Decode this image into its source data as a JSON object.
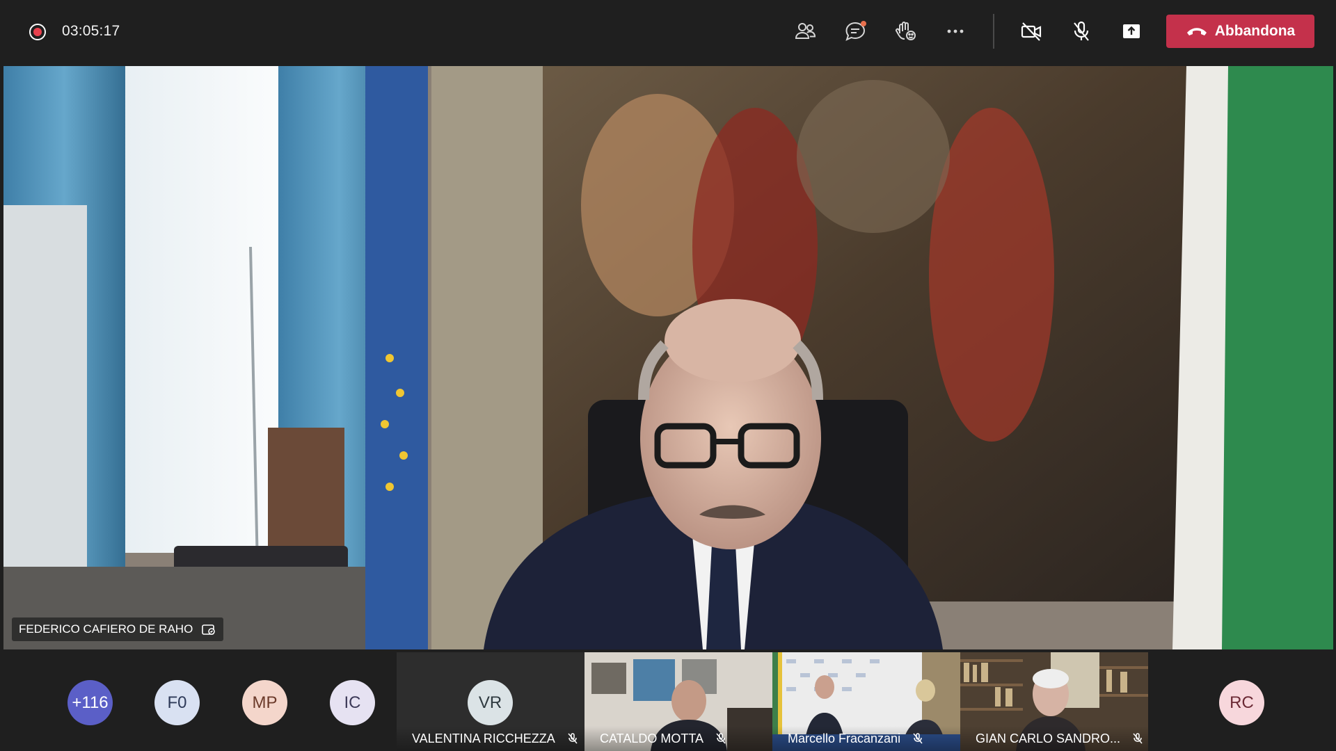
{
  "toolbar": {
    "recording_time": "03:05:17",
    "leave_label": "Abbandona",
    "icons": [
      "participants-icon",
      "chat-icon",
      "reactions-icon",
      "more-icon",
      "camera-off-icon",
      "mic-off-icon",
      "share-icon",
      "hang-up-icon"
    ],
    "chat_badge_color": "#e8704d",
    "leave_color": "#c4314b"
  },
  "main_speaker": {
    "name": "FEDERICO CAFIERO DE RAHO"
  },
  "participants": {
    "overflow_count": "+116",
    "avatars": [
      {
        "initials": "F0",
        "bg": "#d9e1f2",
        "fg": "#2e3a59"
      },
      {
        "initials": "MP",
        "bg": "#f4d6cb",
        "fg": "#6b3a2a"
      },
      {
        "initials": "IC",
        "bg": "#e6e2f2",
        "fg": "#3d3a59"
      },
      {
        "initials": "RC",
        "bg": "#f7d7dc",
        "fg": "#6b2a35"
      }
    ],
    "overflow_bg": "#5b5fc7",
    "tiles": [
      {
        "initials": "VR",
        "name": "VALENTINA RICCHEZZA"
      },
      {
        "name": "CATALDO MOTTA"
      },
      {
        "name": "Marcello Fracanzani"
      },
      {
        "name": "GIAN CARLO SANDRO..."
      }
    ]
  }
}
